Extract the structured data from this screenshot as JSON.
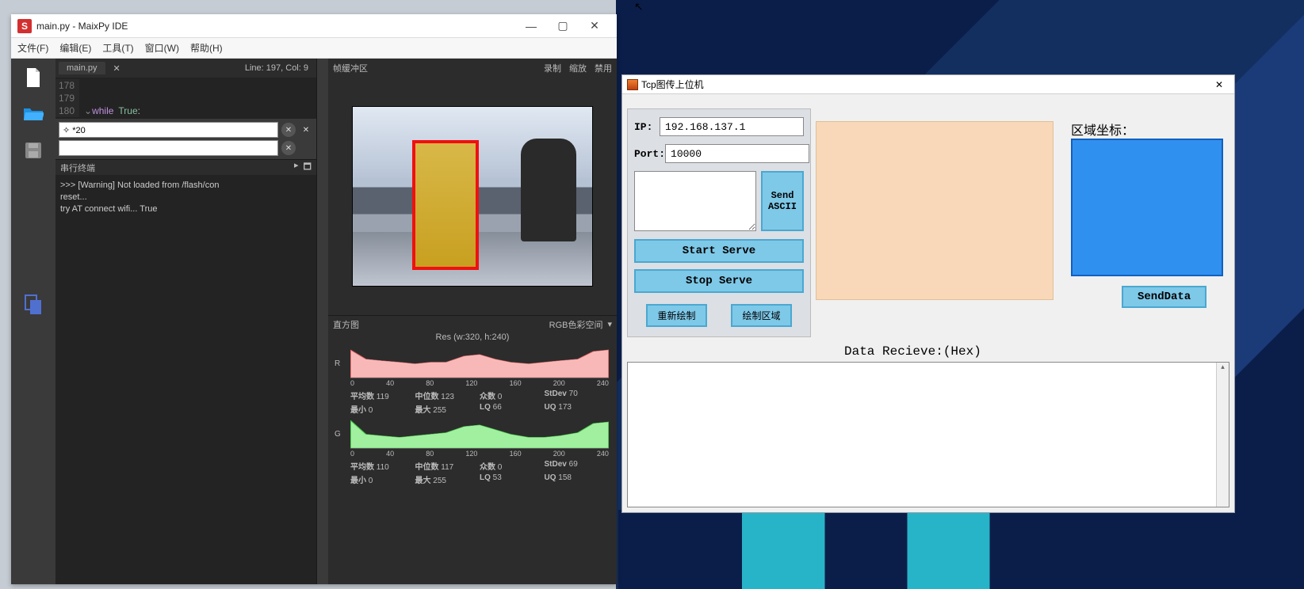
{
  "ide": {
    "title": "main.py - MaixPy IDE",
    "menus": {
      "file": "文件(F)",
      "edit": "编辑(E)",
      "tools": "工具(T)",
      "window": "窗口(W)",
      "help": "帮助(H)"
    },
    "tab": "main.py",
    "cursor_pos": "Line: 197, Col: 9",
    "code_lines": [
      {
        "n": "178",
        "t": ""
      },
      {
        "n": "179",
        "t": ""
      },
      {
        "n": "180",
        "t": "while True:",
        "kw": "while",
        "lit": "True"
      }
    ],
    "search": {
      "value": "✧ *20"
    },
    "term_title": "串行终端",
    "term_lines": [
      ">>> [Warning] Not loaded from /flash/con",
      "reset...",
      "try AT connect wifi... True"
    ],
    "fb_title": "帧缓冲区",
    "fb_ctrl": {
      "rec": "录制",
      "zoom": "缩放",
      "dis": "禁用"
    },
    "hist_title": "直方图",
    "hist_space": "RGB色彩空间",
    "hist_res": "Res (w:320, h:240)",
    "hist_ticks": [
      "0",
      "40",
      "80",
      "120",
      "160",
      "200",
      "240"
    ],
    "hist_r": {
      "label": "R",
      "mean_l": "平均数",
      "mean": "119",
      "med_l": "中位数",
      "med": "123",
      "mode_l": "众数",
      "mode": "0",
      "std_l": "StDev",
      "std": "70",
      "min_l": "最小",
      "min": "0",
      "max_l": "最大",
      "max": "255",
      "lq_l": "LQ",
      "lq": "66",
      "uq_l": "UQ",
      "uq": "173"
    },
    "hist_g": {
      "label": "G",
      "mean_l": "平均数",
      "mean": "110",
      "med_l": "中位数",
      "med": "117",
      "mode_l": "众数",
      "mode": "0",
      "std_l": "StDev",
      "std": "69",
      "min_l": "最小",
      "min": "0",
      "max_l": "最大",
      "max": "255",
      "lq_l": "LQ",
      "lq": "53",
      "uq_l": "UQ",
      "uq": "158"
    }
  },
  "tcp": {
    "title": "Tcp图传上位机",
    "ip_l": "IP:",
    "ip": "192.168.137.1",
    "port_l": "Port:",
    "port": "10000",
    "send_ascii": "Send ASCII",
    "start": "Start Serve",
    "stop": "Stop Serve",
    "redraw": "重新绘制",
    "drawreg": "绘制区域",
    "region_lbl": "区域坐标：",
    "send_data": "SendData",
    "recv_lbl": "Data Recieve:(Hex)"
  },
  "chart_data": [
    {
      "type": "area",
      "series_name": "R",
      "x_range": [
        0,
        255
      ],
      "ticks": [
        0,
        40,
        80,
        120,
        160,
        200,
        240
      ],
      "stats": {
        "mean": 119,
        "median": 123,
        "mode": 0,
        "stdev": 70,
        "min": 0,
        "max": 255,
        "lq": 66,
        "uq": 173
      },
      "approx_envelope_y": [
        0.9,
        0.6,
        0.55,
        0.5,
        0.45,
        0.5,
        0.5,
        0.7,
        0.75,
        0.6,
        0.5,
        0.45,
        0.5,
        0.55,
        0.6,
        0.9
      ]
    },
    {
      "type": "area",
      "series_name": "G",
      "x_range": [
        0,
        255
      ],
      "ticks": [
        0,
        40,
        80,
        120,
        160,
        200,
        240
      ],
      "stats": {
        "mean": 110,
        "median": 117,
        "mode": 0,
        "stdev": 69,
        "min": 0,
        "max": 255,
        "lq": 53,
        "uq": 158
      },
      "approx_envelope_y": [
        0.9,
        0.45,
        0.4,
        0.35,
        0.4,
        0.45,
        0.5,
        0.7,
        0.75,
        0.6,
        0.45,
        0.35,
        0.35,
        0.4,
        0.5,
        0.85
      ]
    }
  ]
}
